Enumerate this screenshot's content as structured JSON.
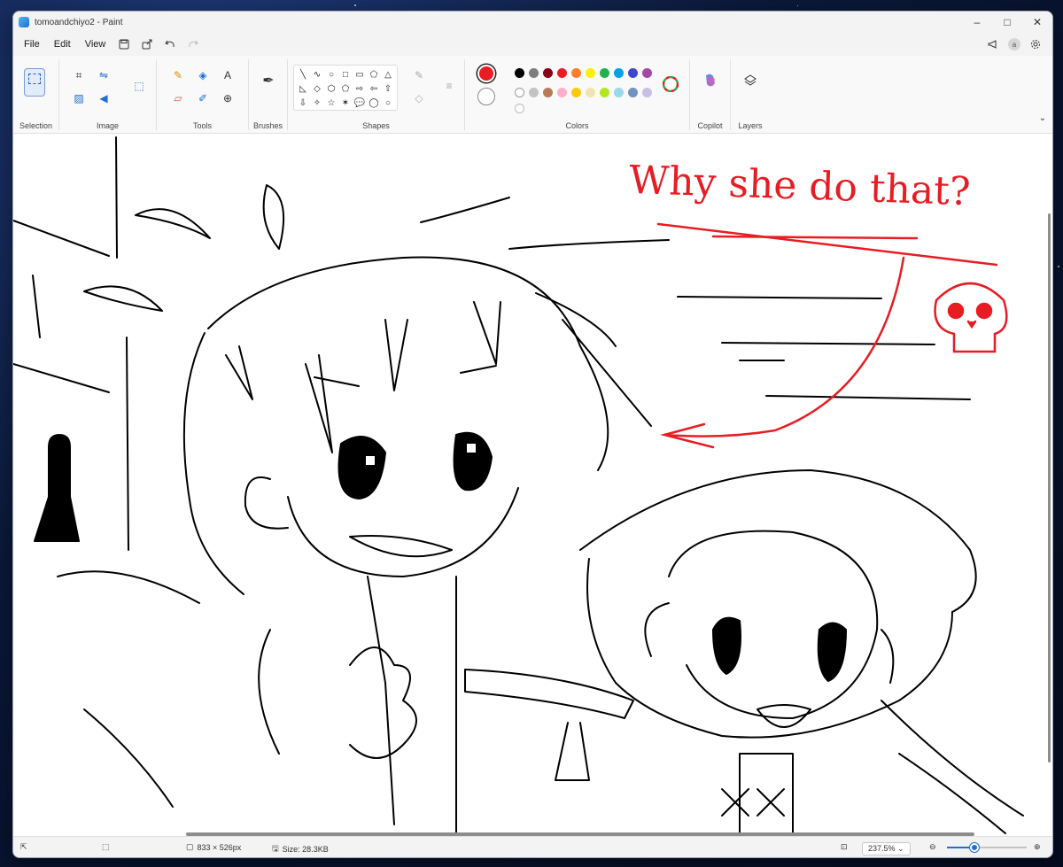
{
  "window": {
    "title": "tomoandchiyo2 - Paint",
    "min": "–",
    "max": "□",
    "close": "✕"
  },
  "menu": {
    "file": "File",
    "edit": "Edit",
    "view": "View"
  },
  "ribbon": {
    "groups": {
      "selection": "Selection",
      "image": "Image",
      "tools": "Tools",
      "brushes": "Brushes",
      "shapes": "Shapes",
      "colors": "Colors",
      "copilot": "Copilot",
      "layers": "Layers"
    },
    "tools_text_label": "A",
    "primary_color": "#e81c23",
    "palette_row1": [
      "#000000",
      "#7f7f7f",
      "#880015",
      "#ed1c24",
      "#ff7f27",
      "#fff200",
      "#22b14c",
      "#00a2e8",
      "#3f48cc",
      "#a349a4"
    ],
    "palette_row2": [
      "#ffffff",
      "#c3c3c3",
      "#b97a57",
      "#ffaec9",
      "#ffc90e",
      "#efe4b0",
      "#b5e61d",
      "#99d9ea",
      "#7092be",
      "#c8bfe7"
    ],
    "shapes": [
      "╲",
      "∿",
      "○",
      "□",
      "▭",
      "⬠",
      "△",
      "◺",
      "◇",
      "⬡",
      "⬠",
      "⇨",
      "⇦",
      "⇧",
      "⇩",
      "✧",
      "☆",
      "✶",
      "💬",
      "◯",
      "○",
      "♡"
    ]
  },
  "canvas": {
    "annotation_text": "Why she do that?",
    "accent": "#e81c23"
  },
  "status": {
    "dimensions": "833 × 526px",
    "size": "Size: 28.3KB",
    "zoom": "237.5%",
    "zoom_fraction": 0.34
  }
}
